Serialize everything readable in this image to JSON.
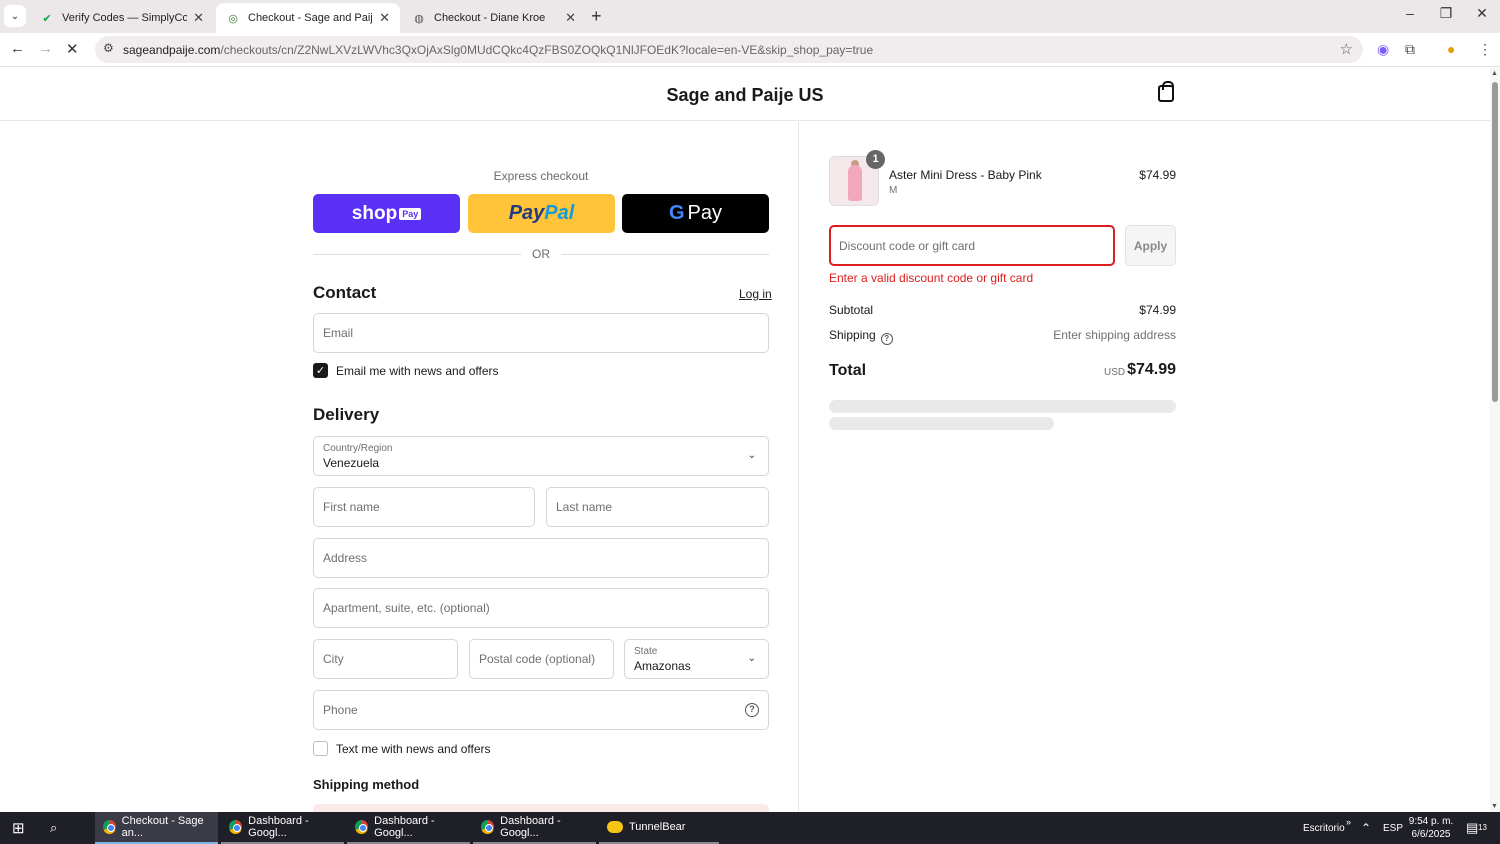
{
  "browser": {
    "tabs": [
      {
        "title": "Verify Codes — SimplyCodes",
        "icon": "simplycodes-icon"
      },
      {
        "title": "Checkout - Sage and Paije US",
        "icon": "sage-paije-icon"
      },
      {
        "title": "Checkout - Diane Kroe",
        "icon": "globe-icon"
      }
    ],
    "url_host": "sageandpaije.com",
    "url_path": "/checkouts/cn/Z2NwLXVzLWVhc3QxOjAxSlg0MUdCQkc4QzFBS0ZOQkQ1NlJFOEdK?locale=en-VE&skip_shop_pay=true"
  },
  "header": {
    "shop_name": "Sage and Paije US"
  },
  "express": {
    "label": "Express checkout",
    "shop_pay_text": "shop",
    "shop_pay_tag": "Pay",
    "paypal_pay": "Pay",
    "paypal_pal": "Pal",
    "gpay_g": "G",
    "gpay_text": "Pay",
    "or_text": "OR"
  },
  "contact": {
    "heading": "Contact",
    "login_link": "Log in",
    "email_placeholder": "Email",
    "news_checkbox_label": "Email me with news and offers",
    "news_checked": true
  },
  "delivery": {
    "heading": "Delivery",
    "country_label": "Country/Region",
    "country_value": "Venezuela",
    "first_name_placeholder": "First name",
    "last_name_placeholder": "Last name",
    "address_placeholder": "Address",
    "apartment_placeholder": "Apartment, suite, etc. (optional)",
    "city_placeholder": "City",
    "postal_placeholder": "Postal code (optional)",
    "state_label": "State",
    "state_value": "Amazonas",
    "phone_placeholder": "Phone",
    "sms_checkbox_label": "Text me with news and offers",
    "sms_checked": false,
    "shipping_method_heading": "Shipping method"
  },
  "summary": {
    "product_name": "Aster Mini Dress - Baby Pink",
    "product_variant": "M",
    "product_price": "$74.99",
    "quantity": "1",
    "discount_placeholder": "Discount code or gift card",
    "apply_label": "Apply",
    "error_text": "Enter a valid discount code or gift card",
    "subtotal_label": "Subtotal",
    "subtotal_value": "$74.99",
    "shipping_label": "Shipping",
    "shipping_value": "Enter shipping address",
    "total_label": "Total",
    "total_currency": "USD",
    "total_value": "$74.99"
  },
  "taskbar": {
    "items": [
      {
        "label": "Checkout - Sage an...",
        "icon": "chrome-icon"
      },
      {
        "label": "Dashboard - Googl...",
        "icon": "chrome-icon"
      },
      {
        "label": "Dashboard - Googl...",
        "icon": "chrome-icon"
      },
      {
        "label": "Dashboard - Googl...",
        "icon": "chrome-icon"
      },
      {
        "label": "TunnelBear",
        "icon": "tunnelbear-icon"
      }
    ],
    "desktop_label": "Escritorio",
    "language": "ESP",
    "time": "9:54 p. m.",
    "date": "6/6/2025",
    "notification_count": "13"
  },
  "colors": {
    "error": "#dd1d1d",
    "shop_pay": "#5a31f4",
    "paypal": "#ffc439",
    "gpay": "#000000"
  }
}
